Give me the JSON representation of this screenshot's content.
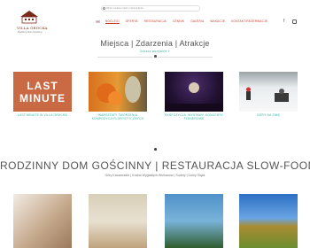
{
  "logo": {
    "name": "VILLA GROCKA",
    "subtitle": "Rodzinny Dom Gościnny"
  },
  "search": {
    "placeholder": "Wpisz szukane hasło i naciśnij Enter"
  },
  "nav": {
    "items": [
      "Noclegi",
      "Oferta",
      "Restauracja",
      "Cennik",
      "Galeria",
      "Wakacje",
      "Kontakt/Rezerwacje"
    ],
    "active_index": 0,
    "accent": "#c0392b"
  },
  "section1": {
    "title": "Miejsca | Zdarzenia | Atrakcje",
    "link": "Zobacz wszystkie »",
    "tiles": [
      {
        "caption": "Last minute w Villa Grocka",
        "image_text_1": "LAST",
        "image_text_2": "MINUTE"
      },
      {
        "caption": "Warsztaty tworzenia kompozycji florystycznych"
      },
      {
        "caption": "Ekspozycja, wystawy, koncerty plenerowe"
      },
      {
        "caption": "Góry na zimę"
      }
    ]
  },
  "section2": {
    "title": "RODZINNY DOM GOŚCINNY | RESTAURACJA SLOW-FOOD",
    "subtitle": "Góry Kaczawskie | Kraina Wygasłych Wulkanów | Sudety | Dolny Śląsk"
  },
  "colors": {
    "accent": "#2fb1a3",
    "nav": "#c0392b"
  }
}
